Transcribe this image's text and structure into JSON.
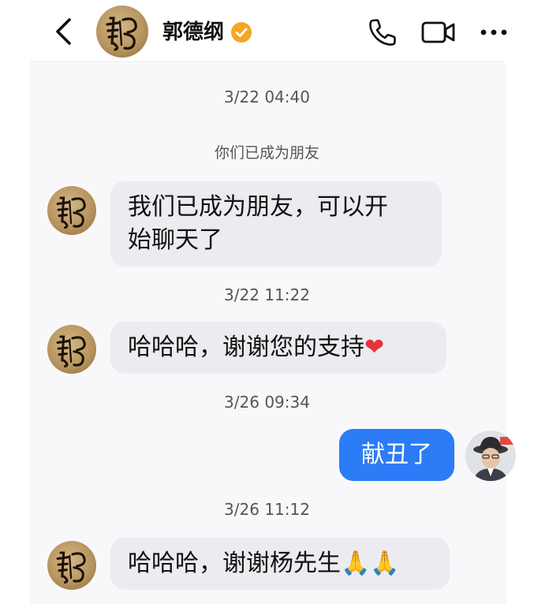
{
  "header": {
    "contact_name": "郭德纲",
    "verified": true,
    "icons": {
      "back": "chevron-left-icon",
      "phone": "phone-icon",
      "video": "video-camera-icon",
      "more": "more-dots-icon"
    }
  },
  "conversation": {
    "timestamps": [
      "3/22 04:40",
      "3/22 11:22",
      "3/26 09:34",
      "3/26 11:12"
    ],
    "system_message": "你们已成为朋友",
    "messages": [
      {
        "direction": "incoming",
        "line1": "我们已成为朋友，可以开",
        "line2": "始聊天了"
      },
      {
        "direction": "incoming",
        "text": "哈哈哈，谢谢您的支持",
        "emoji": "❤"
      },
      {
        "direction": "outgoing",
        "text": "献丑了"
      },
      {
        "direction": "incoming",
        "text": "哈哈哈，谢谢杨先生",
        "emoji": "🙏🙏"
      }
    ]
  },
  "colors": {
    "outgoing_bubble": "#2b7cf6",
    "incoming_bubble": "#ececf0",
    "verified_badge": "#f5a623",
    "heart": "#e8323c"
  }
}
